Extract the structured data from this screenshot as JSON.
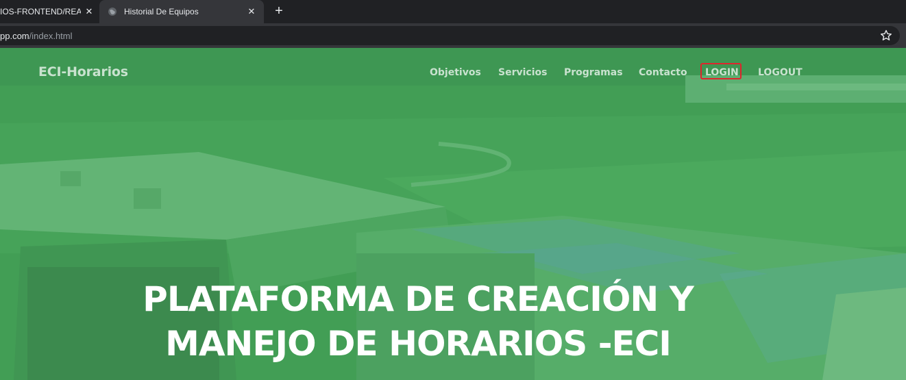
{
  "browser": {
    "tabs": [
      {
        "title": "IOS-FRONTEND/READ"
      },
      {
        "title": "Historial De Equipos"
      }
    ],
    "url": {
      "host": "pp.com",
      "path": "/index.html"
    },
    "icons": {
      "tab_favicon": "globe-icon",
      "close": "close-icon",
      "new_tab": "plus-icon",
      "bookmark": "star-icon"
    }
  },
  "site": {
    "brand": "ECI-Horarios",
    "nav": [
      {
        "label": "Objetivos"
      },
      {
        "label": "Servicios"
      },
      {
        "label": "Programas"
      },
      {
        "label": "Contacto"
      },
      {
        "label": "LOGIN"
      },
      {
        "label": "LOGOUT"
      }
    ],
    "highlight_color": "#e0242c",
    "hero": {
      "line1": "PLATAFORMA DE CREACIÓN Y",
      "line2": "MANEJO DE HORARIOS -ECI"
    },
    "overlay_color": "#3e9650"
  }
}
